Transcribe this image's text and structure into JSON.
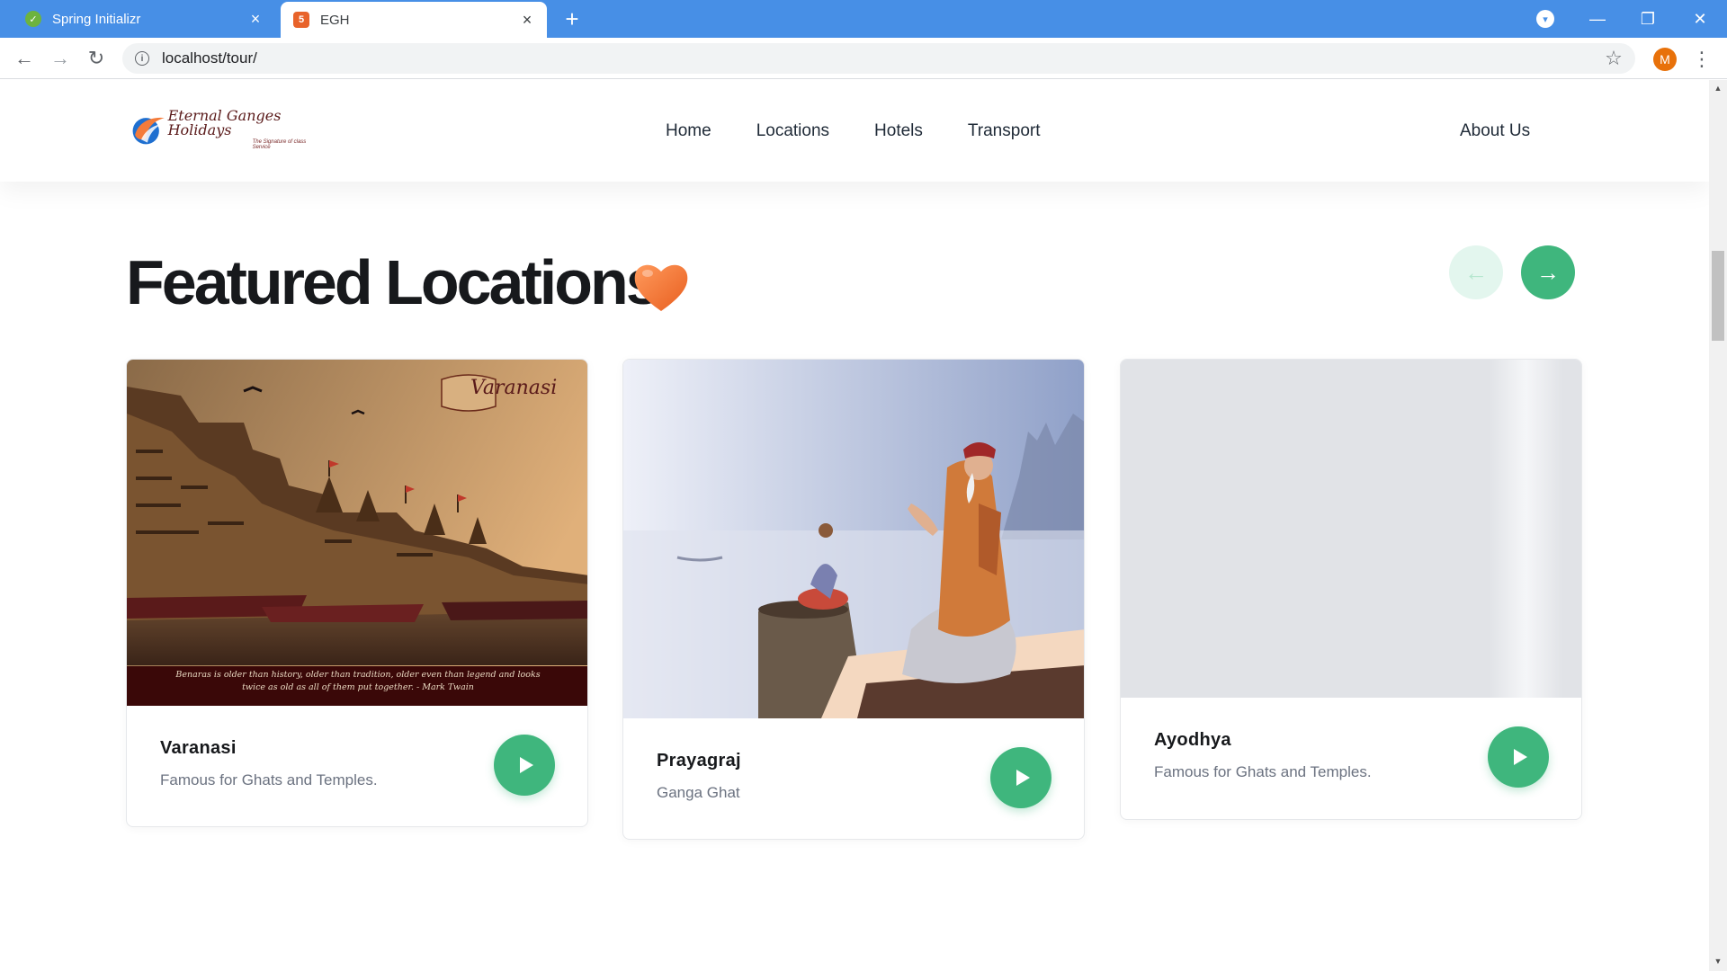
{
  "browser": {
    "tabs": [
      {
        "title": "Spring Initializr",
        "favicon": "spring-leaf-icon",
        "active": false
      },
      {
        "title": "EGH",
        "favicon": "html-icon",
        "active": true
      }
    ],
    "url": "localhost/tour/",
    "profile_initial": "M",
    "glyphs": {
      "close": "×",
      "new_tab": "+",
      "back": "←",
      "forward": "→",
      "reload": "↻",
      "info": "i",
      "star": "☆",
      "menu": "⋮",
      "minimize": "—",
      "restore": "❐",
      "window_close": "✕",
      "dropdown": "▾",
      "scroll_up": "▲",
      "scroll_down": "▼"
    }
  },
  "site": {
    "logo": {
      "name": "Eternal Ganges Holidays",
      "tagline": "The Signature of class Service"
    },
    "nav": {
      "home": "Home",
      "locations": "Locations",
      "hotels": "Hotels",
      "transport": "Transport",
      "about": "About Us"
    },
    "section": {
      "title": "Featured Locations",
      "prev_glyph": "←",
      "next_glyph": "→"
    },
    "cards": [
      {
        "name": "Varanasi",
        "description": "Famous for Ghats and Temples.",
        "image_title": "Varanasi",
        "image_caption": "Benaras is older than history, older than tradition, older even than legend and looks twice as old as all of them put together. - Mark Twain"
      },
      {
        "name": "Prayagraj",
        "description": "Ganga Ghat"
      },
      {
        "name": "Ayodhya",
        "description": "Famous for Ghats and Temples."
      }
    ],
    "colors": {
      "accent": "#3fb67d",
      "accent_light": "#e3f6ee",
      "heart": "#f47b3a",
      "title": "#17191c"
    }
  }
}
